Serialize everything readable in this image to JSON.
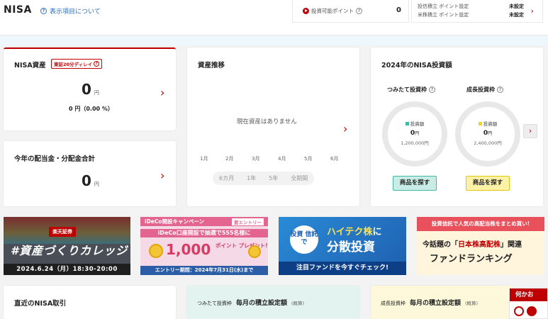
{
  "header": {
    "title": "NISA",
    "help_link": "表示項目について",
    "points_label": "投資可能ポイント",
    "points_value": "0",
    "settings": [
      {
        "label": "投信積立 ポイント設定",
        "value": "未設定"
      },
      {
        "label": "米株積立 ポイント設定",
        "value": "未設定"
      }
    ]
  },
  "assets": {
    "title": "NISA資産",
    "delay_badge": "東証20分ディレイ",
    "amount": "0",
    "unit": "円",
    "change": "0 円（0.00 %）"
  },
  "dividend": {
    "title": "今年の配当金・分配金合計",
    "amount": "0",
    "unit": "円"
  },
  "trend": {
    "title": "資産推移",
    "empty_message": "現在資産はありません",
    "months": [
      "1月",
      "2月",
      "3月",
      "4月",
      "5月",
      "6月"
    ],
    "periods": [
      "6カ月",
      "1年",
      "5年",
      "全期間"
    ]
  },
  "investment": {
    "title": "2024年のNISA投資額",
    "tsumitate": {
      "label": "つみたて投資枠",
      "legend": "投資額",
      "amount": "0",
      "unit": "円",
      "limit": "1,200,000円",
      "button": "商品を探す"
    },
    "seichou": {
      "label": "成長投資枠",
      "legend": "投資額",
      "amount": "0",
      "unit": "円",
      "limit": "2,400,000円",
      "button": "商品を探す"
    }
  },
  "banners": {
    "b1": {
      "badge": "楽天証券",
      "title": "#資産づくりカレッジ",
      "date": "2024.6.24（月）18:30-20:00"
    },
    "b2": {
      "head": "iDeCo開設キャンペーン",
      "entry": "要エントリー",
      "line1": "iDeCo口座開設で抽選で555名様に",
      "big": "1,000",
      "pt": "ポイント プレゼント!",
      "foot": "エントリー期間：2024年7月31日(水)まで"
    },
    "b3": {
      "circle": "投資 信託で",
      "line1_a": "ハイテク株",
      "line1_b": "に",
      "line2": "分散投資",
      "foot": "注目ファンドを今すぐチェック!"
    },
    "b4": {
      "head": "投資信託で人気の高配当株をまとめ買い!",
      "line1_a": "今話題の「",
      "line1_b": "日本株高配株",
      "line1_c": "」関連",
      "line2": "ファンドランキング"
    }
  },
  "bottom": {
    "recent_title": "直近のNISA取引",
    "tsumitate_tag": "つみたて投資枠",
    "tsumitate_title": "毎月の積立設定額",
    "tsumitate_note": "(概算)",
    "seichou_tag": "成長投資枠",
    "seichou_title": "毎月の積立設定額",
    "seichou_note": "(概算)",
    "help_head": "何かお"
  },
  "colors": {
    "accent": "#bf0000",
    "link": "#2c6fbf",
    "tsumitate": "#3fb8a6",
    "seichou": "#f2d422"
  }
}
